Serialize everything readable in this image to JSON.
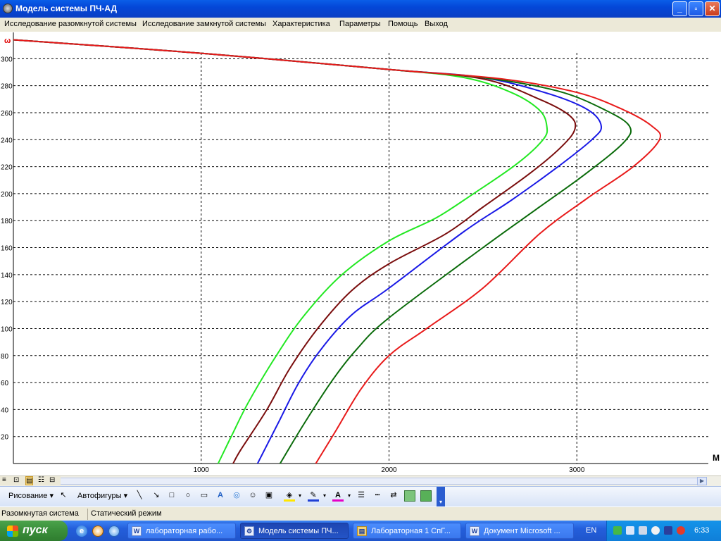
{
  "window": {
    "title": "Модель системы ПЧ-АД",
    "buttons": {
      "minimize": "_",
      "maximize": "▫",
      "close": "✕"
    }
  },
  "menu": [
    "Исследование разомкнутой системы",
    "Исследование замкнутой системы",
    "Характеристика",
    "Параметры",
    "Помощь",
    "Выход"
  ],
  "chart_data": {
    "type": "line",
    "ylabel": "ω",
    "xlabel": "M",
    "xlim": [
      0,
      3700
    ],
    "ylim": [
      0,
      320
    ],
    "xticks": [
      1000,
      2000,
      3000
    ],
    "yticks": [
      20,
      40,
      60,
      80,
      100,
      120,
      140,
      160,
      180,
      200,
      220,
      240,
      260,
      280,
      300
    ],
    "grid": true,
    "series": [
      {
        "color": "#22e822",
        "points": [
          [
            0,
            314
          ],
          [
            1000,
            304
          ],
          [
            2000,
            292
          ],
          [
            2400,
            286
          ],
          [
            2650,
            275
          ],
          [
            2800,
            262
          ],
          [
            2840,
            250
          ],
          [
            2820,
            240
          ],
          [
            2680,
            222
          ],
          [
            2450,
            200
          ],
          [
            2250,
            182
          ],
          [
            2000,
            165
          ],
          [
            1750,
            140
          ],
          [
            1550,
            110
          ],
          [
            1400,
            80
          ],
          [
            1250,
            45
          ],
          [
            1160,
            20
          ],
          [
            1090,
            0
          ]
        ]
      },
      {
        "color": "#7a0d0d",
        "points": [
          [
            0,
            314
          ],
          [
            1000,
            304
          ],
          [
            2000,
            292
          ],
          [
            2500,
            285
          ],
          [
            2800,
            270
          ],
          [
            2960,
            258
          ],
          [
            2990,
            248
          ],
          [
            2920,
            235
          ],
          [
            2750,
            215
          ],
          [
            2500,
            190
          ],
          [
            2300,
            170
          ],
          [
            2000,
            148
          ],
          [
            1800,
            128
          ],
          [
            1620,
            100
          ],
          [
            1470,
            70
          ],
          [
            1350,
            40
          ],
          [
            1210,
            10
          ],
          [
            1170,
            0
          ]
        ]
      },
      {
        "color": "#1919e6",
        "points": [
          [
            0,
            314
          ],
          [
            1000,
            304
          ],
          [
            2000,
            292
          ],
          [
            2500,
            286
          ],
          [
            2850,
            274
          ],
          [
            3060,
            262
          ],
          [
            3130,
            250
          ],
          [
            3080,
            240
          ],
          [
            2900,
            220
          ],
          [
            2650,
            195
          ],
          [
            2400,
            172
          ],
          [
            2000,
            130
          ],
          [
            1800,
            110
          ],
          [
            1640,
            85
          ],
          [
            1520,
            60
          ],
          [
            1410,
            30
          ],
          [
            1300,
            0
          ]
        ]
      },
      {
        "color": "#0a6b0a",
        "points": [
          [
            0,
            314
          ],
          [
            1000,
            304
          ],
          [
            2000,
            292
          ],
          [
            2500,
            286
          ],
          [
            2900,
            276
          ],
          [
            3150,
            262
          ],
          [
            3280,
            250
          ],
          [
            3250,
            238
          ],
          [
            3050,
            215
          ],
          [
            2800,
            190
          ],
          [
            2500,
            160
          ],
          [
            2000,
            108
          ],
          [
            1830,
            85
          ],
          [
            1700,
            62
          ],
          [
            1550,
            30
          ],
          [
            1420,
            0
          ]
        ]
      },
      {
        "color": "#e81a1a",
        "points": [
          [
            0,
            314
          ],
          [
            1000,
            304
          ],
          [
            2000,
            292
          ],
          [
            2600,
            285
          ],
          [
            3000,
            275
          ],
          [
            3250,
            262
          ],
          [
            3400,
            250
          ],
          [
            3440,
            240
          ],
          [
            3300,
            220
          ],
          [
            3050,
            196
          ],
          [
            2800,
            170
          ],
          [
            2500,
            130
          ],
          [
            2200,
            100
          ],
          [
            2000,
            80
          ],
          [
            1850,
            55
          ],
          [
            1720,
            25
          ],
          [
            1610,
            0
          ]
        ]
      }
    ]
  },
  "toolbar": {
    "draw_label": "Рисование",
    "autoshapes_label": "Автофигуры",
    "view_icons": [
      "≡",
      "⊡",
      "▤",
      "☷",
      "⊟"
    ],
    "tool_icons": [
      "╲",
      "↘",
      "□",
      "○",
      "▭",
      "A",
      "◎",
      "☺",
      "▣"
    ]
  },
  "status": {
    "left": "Разомкнутая система",
    "right": "Статический режим"
  },
  "taskbar": {
    "start_label": "пуск",
    "tasks": [
      {
        "label": "лабораторная рабо...",
        "icon": "W",
        "active": false
      },
      {
        "label": "Модель системы ПЧ...",
        "icon": "⚙",
        "active": true
      },
      {
        "label": "Лабораторная 1 СпГ...",
        "icon": "▤",
        "active": false
      },
      {
        "label": "Документ Microsoft ...",
        "icon": "W",
        "active": false
      }
    ],
    "lang": "EN",
    "clock": "6:33"
  }
}
